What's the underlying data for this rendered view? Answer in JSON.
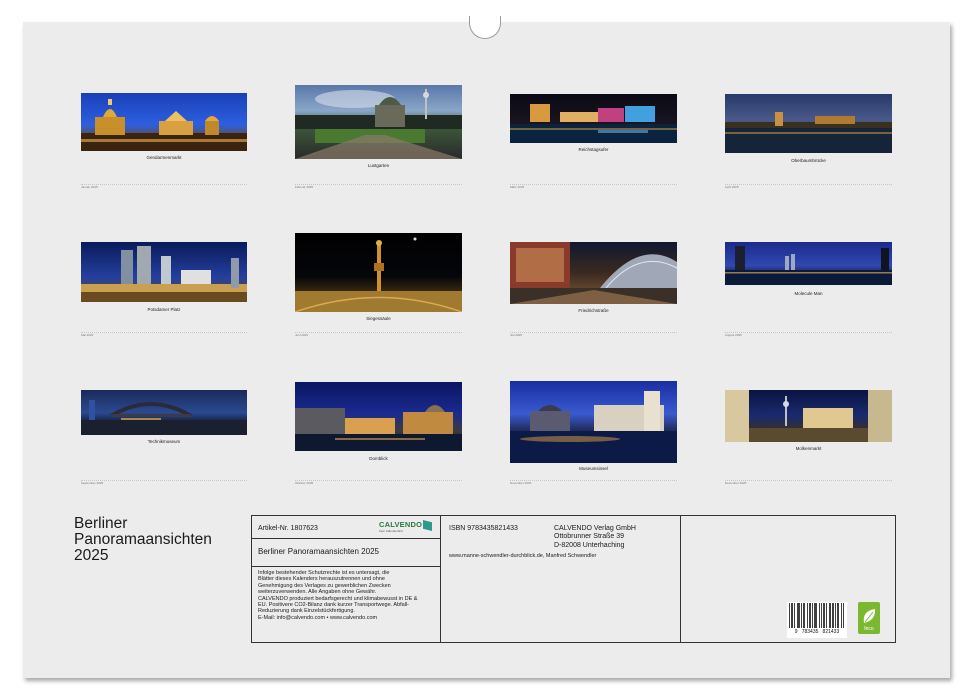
{
  "calendar": {
    "title_lines": [
      "Berliner",
      "Panoramaansichten",
      "2025"
    ]
  },
  "months": [
    {
      "caption": "Gendarmenmarkt",
      "strip": "Januar 2025"
    },
    {
      "caption": "Lustgarten",
      "strip": "Februar 2025"
    },
    {
      "caption": "Reichstagsufer",
      "strip": "März 2025"
    },
    {
      "caption": "Oberbaumbrücke",
      "strip": "April 2025"
    },
    {
      "caption": "Potsdamer Platz",
      "strip": "Mai 2025"
    },
    {
      "caption": "Siegessäule",
      "strip": "Juni 2025"
    },
    {
      "caption": "Friedrichstraße",
      "strip": "Juli 2025"
    },
    {
      "caption": "Molecule Man",
      "strip": "August 2025"
    },
    {
      "caption": "Technikmuseum",
      "strip": "September 2025"
    },
    {
      "caption": "Domblick",
      "strip": "Oktober 2025"
    },
    {
      "caption": "Museumsinsel",
      "strip": "November 2025"
    },
    {
      "caption": "Molkenmarkt",
      "strip": "Dezember 2025"
    }
  ],
  "info": {
    "article": "Artikel-Nr. 1807623",
    "brand": "CALVENDO",
    "brand_sub": "Kein Kalenderbild",
    "subtitle": "Berliner Panoramaansichten 2025",
    "legal": [
      "Infolge bestehender Schutzrechte ist es untersagt, die",
      "Blätter dieses Kalenders herauszutrennen und ohne",
      "Genehmigung des Verlages zu gewerblichen Zwecken",
      "weiterzuverwenden. Alle Angaben ohne Gewähr.",
      "CALVENDO produziert bedarfsgerecht und klimabewusst in DE &",
      "EU. Positivere CO2-Bilanz dank kurzer Transportwege. Abfall-",
      "Reduzierung dank Einzelstückfertigung.",
      "E-Mail: info@calvendo.com • www.calvendo.com"
    ],
    "isbn": "ISBN 9783435821433",
    "publisher": [
      "CALVENDO Verlag GmbH",
      "Ottobrunner Straße 39",
      "D-82008 Unterhaching"
    ],
    "credit": "www.manne-schwendler-durchblick.de, Manfred Schwendler",
    "barcode_digits": "9   783435   821433",
    "eco_label": "feco"
  },
  "colors": {
    "page": "#ececec",
    "ring": "#8a8a8a",
    "eco": "#7cb82f"
  }
}
